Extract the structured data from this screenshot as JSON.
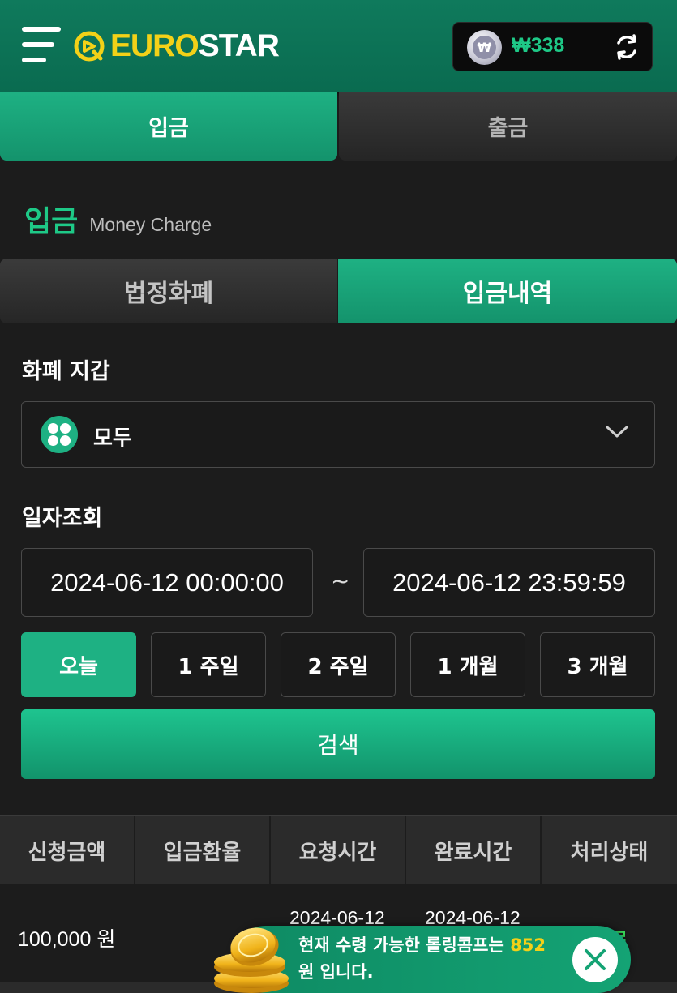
{
  "header": {
    "logo_euro": "EURO",
    "logo_star": "STAR",
    "currency_symbol": "₩",
    "balance": "₩338"
  },
  "tabs_top": [
    "입금",
    "출금"
  ],
  "section": {
    "title_kr": "입금",
    "title_en": "Money Charge"
  },
  "tabs_sub": [
    "법정화폐",
    "입금내역"
  ],
  "wallet": {
    "label": "화폐 지갑",
    "selected": "모두"
  },
  "date": {
    "label": "일자조회",
    "from": "2024-06-12 00:00:00",
    "separator": "~",
    "to": "2024-06-12 23:59:59"
  },
  "ranges": [
    "오늘",
    "1 주일",
    "2 주일",
    "1 개월",
    "3 개월"
  ],
  "search_label": "검색",
  "table": {
    "headers": [
      "신청금액",
      "입금환율",
      "요청시간",
      "완료시간",
      "처리상태"
    ],
    "rows": [
      {
        "amount": "100,000 원",
        "rate": "",
        "requested": "2024-06-12",
        "completed": "2024-06-12",
        "status": "완료"
      }
    ]
  },
  "toast": {
    "before": "현재 수령 가능한 롤링콤프는 ",
    "amount": "852",
    "after": "원 입니다."
  },
  "colors": {
    "accent": "#1eb183",
    "header": "#0f7a5c",
    "highlight": "#f3d118",
    "balance": "#1ec987"
  }
}
